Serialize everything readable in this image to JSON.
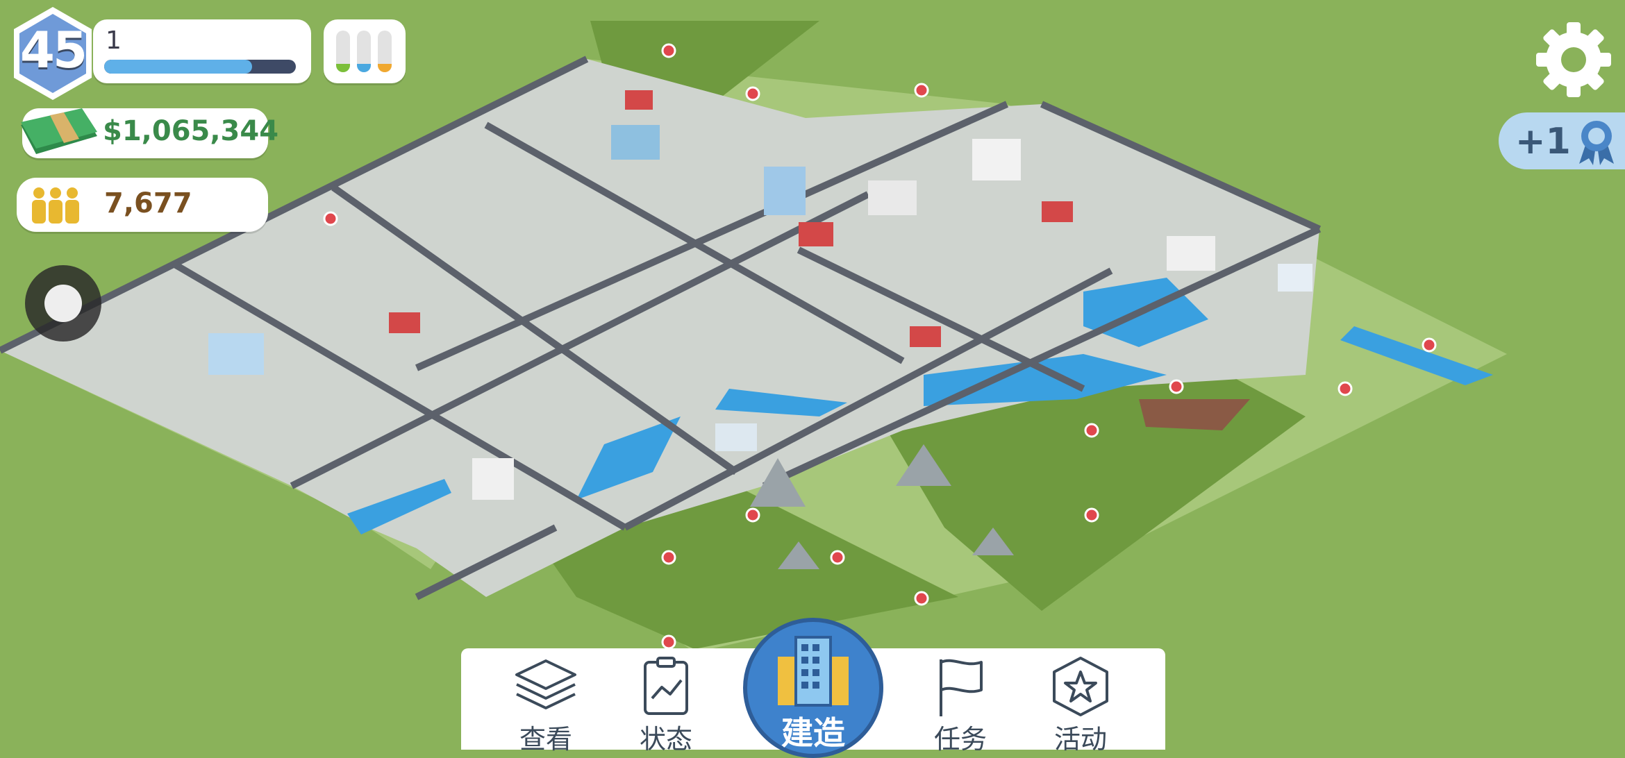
{
  "player": {
    "level": "45",
    "xp_count": "1",
    "xp_progress_fraction": 0.77
  },
  "resources": {
    "bars": [
      {
        "name": "green-resource",
        "color": "#7bbf3a",
        "fill_fraction": 0.2
      },
      {
        "name": "blue-resource",
        "color": "#4aa8e0",
        "fill_fraction": 0.2
      },
      {
        "name": "orange-resource",
        "color": "#f0a830",
        "fill_fraction": 0.2
      }
    ]
  },
  "stats": {
    "money": "$1,065,344",
    "population": "7,677"
  },
  "reward": {
    "text": "+1"
  },
  "icons": {
    "settings": "gear-icon",
    "reward": "ribbon-medal-icon",
    "money": "cash-stack-icon",
    "population": "people-group-icon",
    "view": "layers-icon",
    "status": "clipboard-chart-icon",
    "build": "buildings-icon",
    "quests": "flag-icon",
    "events": "star-hexagon-icon"
  },
  "nav": {
    "view": "查看",
    "status": "状态",
    "build": "建造",
    "quests": "任务",
    "events": "活动"
  },
  "colors": {
    "grass": "#8ab25a",
    "road": "#5c616b",
    "water": "#3aa0e0",
    "accent": "#3e82cc"
  }
}
